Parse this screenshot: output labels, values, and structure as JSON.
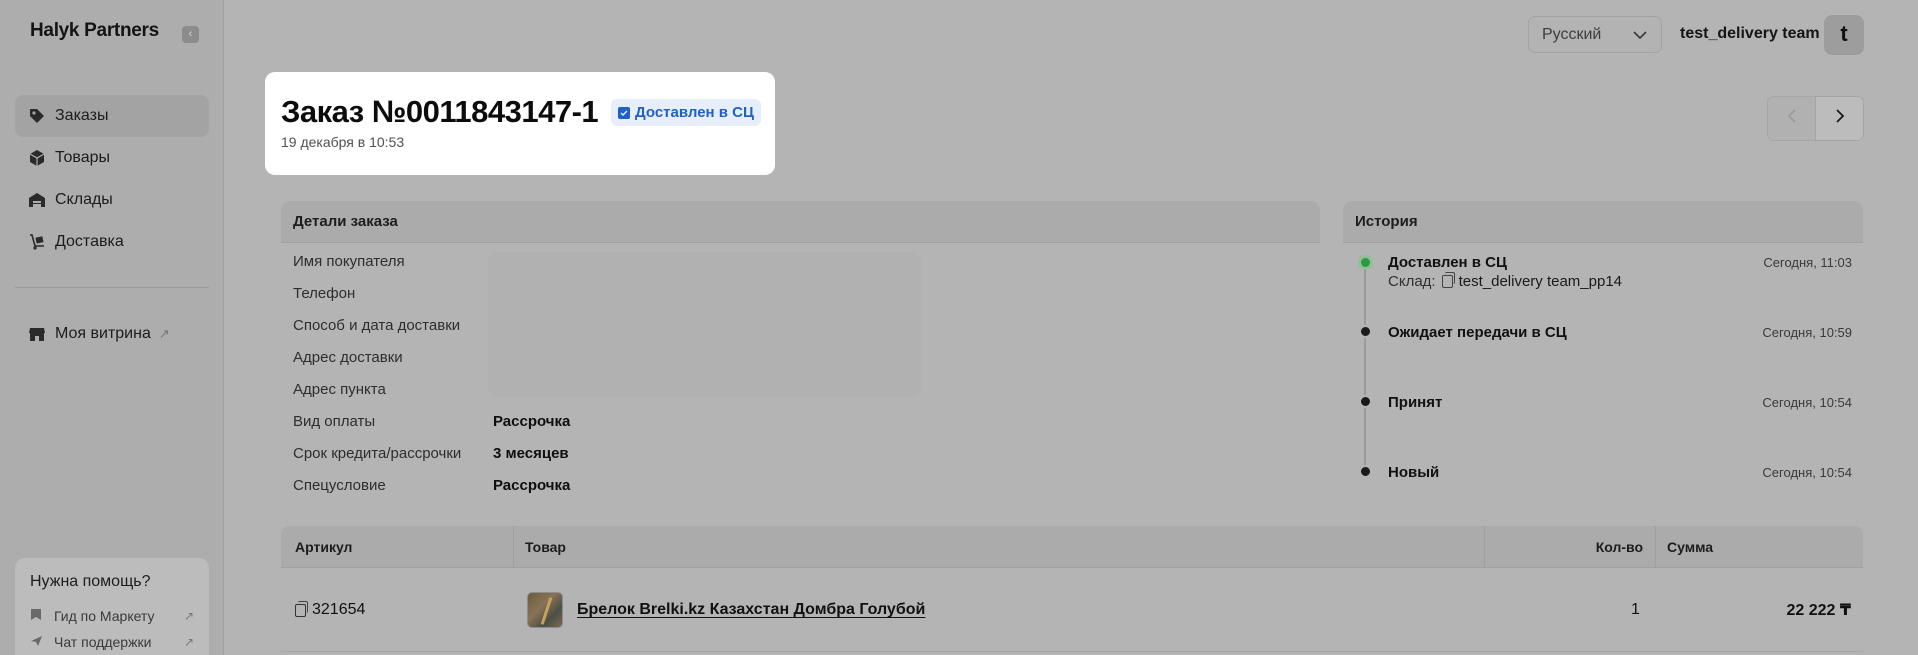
{
  "app": {
    "brand": "Halyk Partners",
    "collapse_icon": "‹"
  },
  "sidebar": {
    "items": [
      {
        "label": "Заказы",
        "icon": "tag-icon",
        "active": true
      },
      {
        "label": "Товары",
        "icon": "box-icon",
        "active": false
      },
      {
        "label": "Склады",
        "icon": "warehouse-icon",
        "active": false
      },
      {
        "label": "Доставка",
        "icon": "dolly-icon",
        "active": false
      }
    ],
    "showcase": {
      "label": "Моя витрина",
      "icon": "store-icon",
      "ext": "↗"
    },
    "help": {
      "title": "Нужна помощь?",
      "links": [
        {
          "label": "Гид по Маркету",
          "icon": "bookmark-icon",
          "ext": "↗"
        },
        {
          "label": "Чат поддержки",
          "icon": "send-icon",
          "ext": "↗"
        }
      ]
    }
  },
  "topbar": {
    "language": "Русский",
    "user_name": "test_delivery team",
    "avatar_letter": "t"
  },
  "order": {
    "title": "Заказ №0011843147-1",
    "date": "19 декабря в 10:53",
    "status": "Доставлен в СЦ",
    "status_color": "#2160c4"
  },
  "details": {
    "heading": "Детали заказа",
    "rows": [
      {
        "label": "Имя покупателя",
        "value": ""
      },
      {
        "label": "Телефон",
        "value": ""
      },
      {
        "label": "Способ и дата доставки",
        "value": ""
      },
      {
        "label": "Адрес доставки",
        "value": ""
      },
      {
        "label": "Адрес пункта",
        "value": ""
      },
      {
        "label": "Вид оплаты",
        "value": "Рассрочка"
      },
      {
        "label": "Срок кредита/рассрочки",
        "value": "3 месяцев"
      },
      {
        "label": "Спецусловие",
        "value": "Рассрочка"
      }
    ]
  },
  "history": {
    "heading": "История",
    "events": [
      {
        "title": "Доставлен в СЦ",
        "time": "Сегодня, 11:03",
        "sub_label": "Склад:",
        "sub_value": "test_delivery team_pp14"
      },
      {
        "title": "Ожидает передачи в СЦ",
        "time": "Сегодня, 10:59"
      },
      {
        "title": "Принят",
        "time": "Сегодня, 10:54"
      },
      {
        "title": "Новый",
        "time": "Сегодня, 10:54"
      }
    ]
  },
  "items_table": {
    "columns": [
      "Артикул",
      "Товар",
      "Кол-во",
      "Сумма"
    ],
    "rows": [
      {
        "sku": "321654",
        "product": "Брелок Brelki.kz Казахстан Домбра Голубой",
        "qty": "1",
        "sum": "22 222 ₸"
      }
    ]
  },
  "pager": {
    "prev_icon": "chevron-left-icon",
    "next_icon": "chevron-right-icon"
  }
}
